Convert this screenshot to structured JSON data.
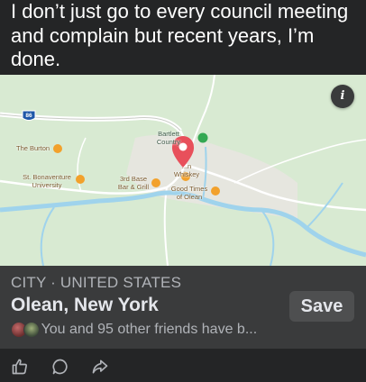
{
  "post": {
    "text": "I don’t just go to every council meeting and complain but recent years, I’m done."
  },
  "map": {
    "highway_shield": "86",
    "labels": {
      "the_burton": "The Burton",
      "st_bonaventure": "St. Bonaventure University",
      "third_base": "3rd Base Bar & Grill",
      "good_times": "Good Times of Olean",
      "bartlett": "Bartlett Country",
      "whiskey": "...n Whiskey"
    },
    "info_button": "i",
    "colors": {
      "land": "#d8ead2",
      "water": "#9fd3ec",
      "road": "#ffffff",
      "pin": "#e8505b",
      "poi_food": "#f2a12c",
      "poi_park": "#34a853"
    }
  },
  "place": {
    "meta": "CITY · UNITED STATES",
    "name": "Olean, New York",
    "friends_text": "You and 95 other friends have b...",
    "save_label": "Save"
  },
  "actions": {
    "icons": [
      "like-icon",
      "comment-icon",
      "share-icon"
    ]
  }
}
